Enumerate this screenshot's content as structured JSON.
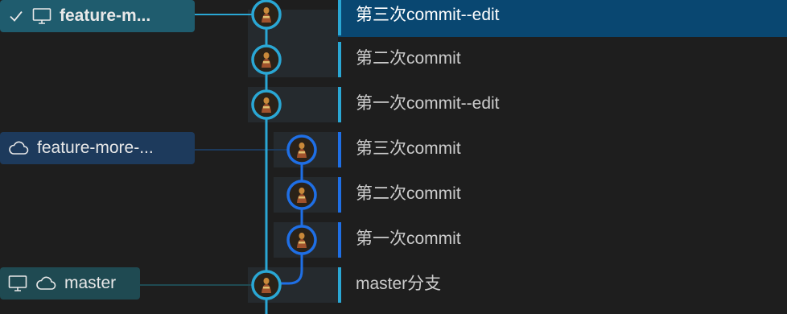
{
  "refs": {
    "current_branch": {
      "label": "feature-m...",
      "icons": [
        "check-icon",
        "computer-icon"
      ]
    },
    "remote_branch": {
      "label": "feature-more-...",
      "icons": [
        "cloud-icon"
      ]
    },
    "master_branch": {
      "label": "master",
      "icons": [
        "computer-icon",
        "cloud-icon"
      ]
    }
  },
  "commits": [
    {
      "message": "第三次commit--edit",
      "lane": "main",
      "selected": true
    },
    {
      "message": "第二次commit",
      "lane": "main",
      "selected": false
    },
    {
      "message": "第一次commit--edit",
      "lane": "main",
      "selected": false
    },
    {
      "message": "第三次commit",
      "lane": "branch",
      "selected": false
    },
    {
      "message": "第二次commit",
      "lane": "branch",
      "selected": false
    },
    {
      "message": "第一次commit",
      "lane": "branch",
      "selected": false
    },
    {
      "message": "master分支",
      "lane": "main",
      "selected": false
    }
  ],
  "colors": {
    "main_lane": "#2aa7d4",
    "branch_lane": "#1f6fe5",
    "selected_row": "#094771",
    "ref_current_bg": "#1f5c6e",
    "ref_remote_bg": "#1d3a5c",
    "ref_master_bg": "#1f4a52"
  }
}
